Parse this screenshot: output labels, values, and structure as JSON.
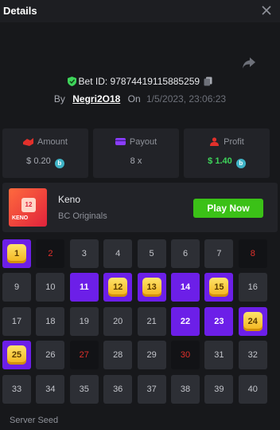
{
  "header": {
    "title": "Details"
  },
  "bet": {
    "id_label": "Bet ID: 97874419115885259",
    "by_label": "By",
    "user": "Negri2O18",
    "on_label": "On",
    "date": "1/5/2023, 23:06:23"
  },
  "stats": [
    {
      "label": "Amount",
      "value": "$ 0.20",
      "icon": "cash-icon",
      "icon_color": "#e2302b"
    },
    {
      "label": "Payout",
      "value": "8 x",
      "icon": "card-icon",
      "icon_color": "#8b3dff"
    },
    {
      "label": "Profit",
      "value": "$ 1.40",
      "icon": "user-icon",
      "icon_color": "#e2302b"
    }
  ],
  "coin_symbol": "b",
  "game": {
    "thumb_number": "12",
    "thumb_text": "KENO",
    "name": "Keno",
    "provider": "BC Originals",
    "play_label": "Play Now"
  },
  "grid": {
    "tiles": [
      {
        "n": "1",
        "s": "win"
      },
      {
        "n": "2",
        "s": "miss"
      },
      {
        "n": "3",
        "s": "plain"
      },
      {
        "n": "4",
        "s": "plain"
      },
      {
        "n": "5",
        "s": "plain"
      },
      {
        "n": "6",
        "s": "plain"
      },
      {
        "n": "7",
        "s": "plain"
      },
      {
        "n": "8",
        "s": "miss"
      },
      {
        "n": "9",
        "s": "plain"
      },
      {
        "n": "10",
        "s": "plain"
      },
      {
        "n": "11",
        "s": "hit"
      },
      {
        "n": "12",
        "s": "win"
      },
      {
        "n": "13",
        "s": "win"
      },
      {
        "n": "14",
        "s": "hit"
      },
      {
        "n": "15",
        "s": "win"
      },
      {
        "n": "16",
        "s": "plain"
      },
      {
        "n": "17",
        "s": "plain"
      },
      {
        "n": "18",
        "s": "plain"
      },
      {
        "n": "19",
        "s": "plain"
      },
      {
        "n": "20",
        "s": "plain"
      },
      {
        "n": "21",
        "s": "plain"
      },
      {
        "n": "22",
        "s": "hit"
      },
      {
        "n": "23",
        "s": "hit"
      },
      {
        "n": "24",
        "s": "win"
      },
      {
        "n": "25",
        "s": "win"
      },
      {
        "n": "26",
        "s": "plain"
      },
      {
        "n": "27",
        "s": "miss"
      },
      {
        "n": "28",
        "s": "plain"
      },
      {
        "n": "29",
        "s": "plain"
      },
      {
        "n": "30",
        "s": "miss"
      },
      {
        "n": "31",
        "s": "plain"
      },
      {
        "n": "32",
        "s": "plain"
      },
      {
        "n": "33",
        "s": "plain"
      },
      {
        "n": "34",
        "s": "plain"
      },
      {
        "n": "35",
        "s": "plain"
      },
      {
        "n": "36",
        "s": "plain"
      },
      {
        "n": "37",
        "s": "plain"
      },
      {
        "n": "38",
        "s": "plain"
      },
      {
        "n": "39",
        "s": "plain"
      },
      {
        "n": "40",
        "s": "plain"
      }
    ]
  },
  "footer": {
    "section_label": "Server Seed"
  },
  "colors": {
    "accent_purple": "#6c1fe8",
    "play_green": "#3bc117",
    "profit_green": "#3ed45a",
    "miss_red": "#e2302b"
  }
}
